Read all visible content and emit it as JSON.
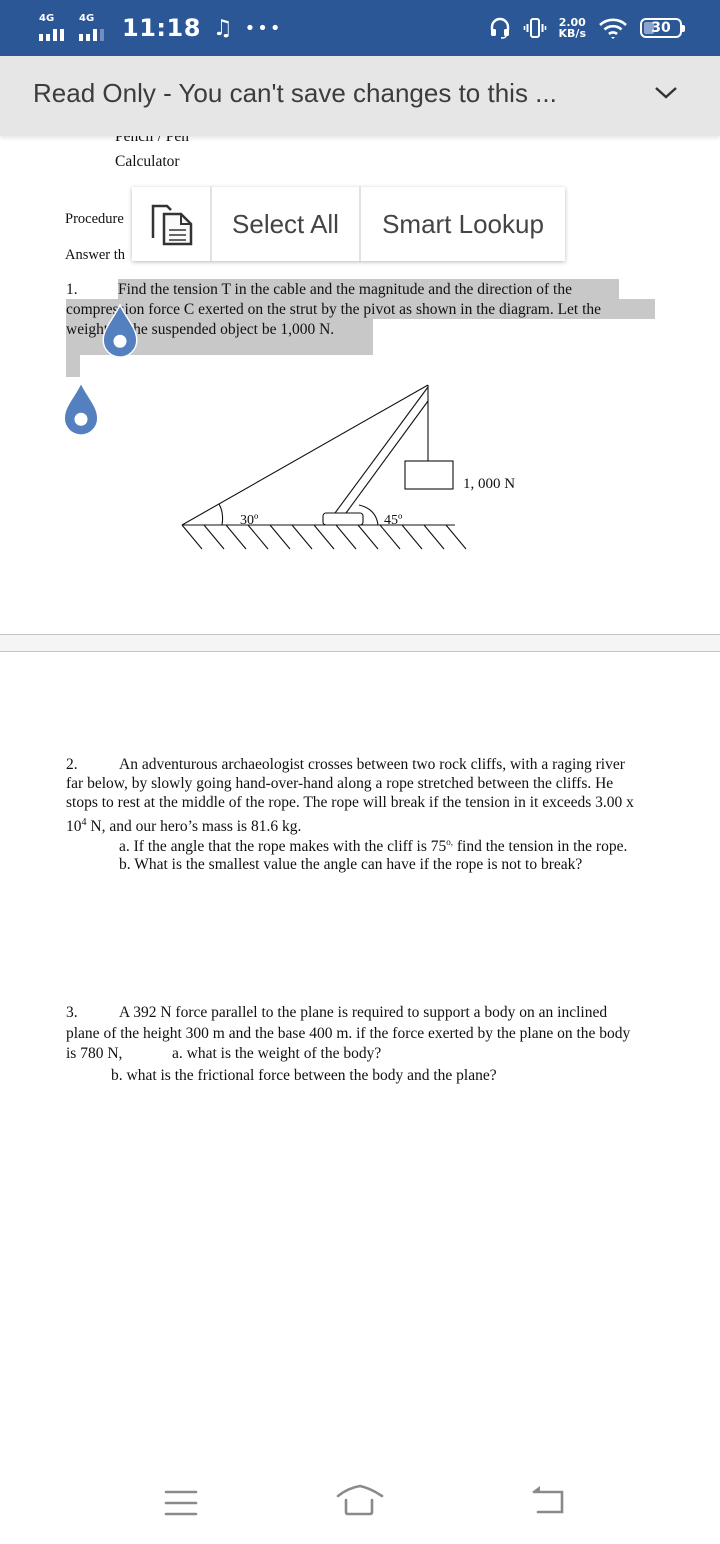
{
  "status_bar": {
    "sim1_label": "4G",
    "sim2_label": "4G",
    "time": "11:18",
    "music_icon": "music-note-icon",
    "more_icon": "more-dots-icon",
    "headset_icon": "headset-icon",
    "vibrate_icon": "vibrate-icon",
    "net_speed_value": "2.00",
    "net_speed_unit": "KB/s",
    "wifi_icon": "wifi-icon",
    "battery_level": "30"
  },
  "banner": {
    "text": "Read Only - You can't save changes to this ...",
    "chevron_icon": "chevron-down-icon"
  },
  "context_menu": {
    "paste_icon": "paste-icon",
    "select_all_label": "Select All",
    "smart_lookup_label": "Smart Lookup"
  },
  "document": {
    "materials": [
      "Pencil / Pen",
      "Calculator"
    ],
    "procedure_label": "Procedure",
    "answer_label": "Answer th",
    "q1": {
      "number": "1.",
      "line1": "Find the tension T in the cable and the magnitude and the direction of the",
      "line2": "compression force C exerted on the strut by the pivot as shown in the diagram. Let the",
      "line3": "weight of the suspended object be 1,000 N."
    },
    "diagram": {
      "angle_cable": "30º",
      "angle_strut": "45º",
      "weight_label": "1, 000 N"
    },
    "q2": {
      "number": "2.",
      "line1": "An adventurous archaeologist crosses between two rock cliffs, with a raging river",
      "line2": "far below, by slowly going hand-over-hand along a rope stretched between the cliffs. He",
      "line3": "stops to rest at the middle of the rope. The rope will break if the tension in it exceeds 3.00 x",
      "line4_pre": "10",
      "line4_sup": "4",
      "line4_post": " N, and our hero’s mass is 81.6 kg.",
      "part_a_pre": "a. If the angle that the rope makes with the cliff is 75",
      "part_a_sup": "o,",
      "part_a_post": " find the tension in the rope.",
      "part_b": "b. What is the smallest value the angle can have if the rope is not to break?"
    },
    "q3": {
      "number": "3.",
      "line1": "A 392 N force parallel to the plane is required to support a body on an inclined",
      "line2": "plane of the height 300 m and the base 400 m. if the force exerted by the plane on the body",
      "line3_pre": "is 780 N,",
      "line3_a": "a. what is the weight of the body?",
      "part_b": "b. what is the frictional force between the body and the plane?"
    }
  },
  "nav_bar": {
    "recents_icon": "recents-menu-icon",
    "home_icon": "home-icon",
    "back_icon": "back-icon"
  }
}
